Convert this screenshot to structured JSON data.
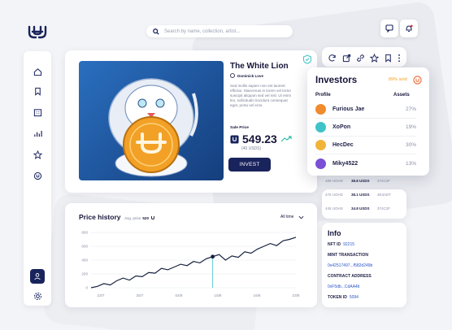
{
  "header": {
    "search_placeholder": "Search by name, collection, artist..."
  },
  "nft": {
    "title": "The White Lion",
    "creator": "Dominick Love",
    "description": "Sed mollis sapien non est laoreet efficitur. Maecenas in lorem vel tortor suscipit aliquam sed vel nisl. Ut enim leo, sollicitudin tincidunt consequat eget, porta vel eros.",
    "sale_label": "Sale Price",
    "price": "549.23",
    "price_sub": "(40 USDS)",
    "invest_label": "INVEST"
  },
  "investors": {
    "title": "Investors",
    "sold": "89% sold",
    "col_profile": "Profile",
    "col_assets": "Assets",
    "rows": [
      {
        "name": "Furious Jae",
        "pct": "27%",
        "color": "#f08b2e"
      },
      {
        "name": "XoPon",
        "pct": "19%",
        "color": "#3ec3c9"
      },
      {
        "name": "HecDec",
        "pct": "30%",
        "color": "#f2b33a"
      },
      {
        "name": "Miky4522",
        "pct": "13%",
        "color": "#7b4fd6"
      }
    ]
  },
  "transactions": [
    {
      "a": "489 UOHS",
      "b": "38.8 USDS",
      "c": "374C2F"
    },
    {
      "a": "475 UOHS",
      "b": "38.1 USDS",
      "c": "4E3ADT"
    },
    {
      "a": "445 UOHS",
      "b": "34.8 USDS",
      "c": "374C2F"
    }
  ],
  "info": {
    "title": "Info",
    "nft_id_label": "NFT ID",
    "nft_id": "92215",
    "mint_label": "MINT TRANSACTION",
    "mint_value": "0x42517497...f582d249b",
    "contract_label": "CONTRACT ADDRESS",
    "contract_value": "0xF5db...CdAA4b",
    "token_label": "TOKEN ID",
    "token_value": "5094"
  },
  "price_history": {
    "title": "Price history",
    "avg_label": "Avg. price",
    "avg_value": "520",
    "range": "All time"
  },
  "chart_data": {
    "type": "line",
    "x": [
      "23/7",
      "",
      "25/7",
      "",
      "",
      "04/8",
      "",
      "",
      "15/8",
      "",
      "",
      "16/8",
      "",
      "",
      "23/8"
    ],
    "y_ticks": [
      0,
      200,
      400,
      600,
      800
    ],
    "ylim": [
      0,
      800
    ],
    "x_tick_labels": [
      "23/7",
      "25/7",
      "04/8",
      "15/8",
      "16/8",
      "23/8"
    ],
    "values": [
      0,
      20,
      60,
      40,
      100,
      140,
      110,
      170,
      160,
      220,
      210,
      280,
      260,
      300,
      340,
      320,
      380,
      360,
      420,
      450,
      480,
      400,
      460,
      440,
      520,
      500,
      560,
      600,
      640,
      610,
      680,
      700,
      730
    ],
    "highlight_index": 19
  },
  "colors": {
    "accent": "#f2a126",
    "navy": "#19235c",
    "blue_bg": "#1f5da8",
    "line": "#18233f",
    "highlight": "#3ec3c9"
  }
}
